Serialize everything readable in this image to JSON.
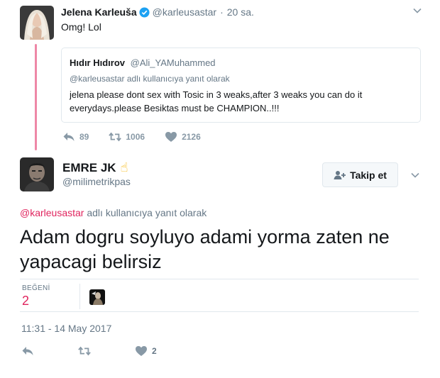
{
  "parent_tweet": {
    "name": "Jelena Karleuša",
    "handle": "@karleusastar",
    "separator": "·",
    "time": "20 sa.",
    "text": "Omg! Lol",
    "quote": {
      "name": "Hıdır Hıdırov",
      "handle": "@Ali_YAMuhammed",
      "reply_context": "@karleusastar adlı kullanıcıya yanıt olarak",
      "text": "jelena please dont sex with Tosic in 3 weaks,after 3 weaks you can do it everydays.please Besiktas must be CHAMPION..!!!"
    },
    "actions": {
      "replies": "89",
      "retweets": "1006",
      "likes": "2126"
    }
  },
  "main_tweet": {
    "name": "EMRE JK",
    "name_emoji": "☝",
    "handle": "@milimetrikpas",
    "follow_label": "Takip et",
    "reply_prefix": "@karleusastar",
    "reply_suffix": " adlı kullanıcıya yanıt olarak",
    "text": "Adam dogru soyluyo adami yorma zaten ne yapacagi belirsiz",
    "likes_label": "BEĞENİ",
    "likes_count": "2",
    "timestamp": "11:31 - 14 May 2017",
    "actions": {
      "likes": "2"
    }
  },
  "colors": {
    "accent": "#e0245e",
    "muted": "#657786",
    "border": "#e1e8ed",
    "verified": "#1da1f2"
  },
  "icons": [
    "verified-badge-icon",
    "chevron-down-icon",
    "reply-icon",
    "retweet-icon",
    "heart-icon",
    "follow-user-icon"
  ]
}
